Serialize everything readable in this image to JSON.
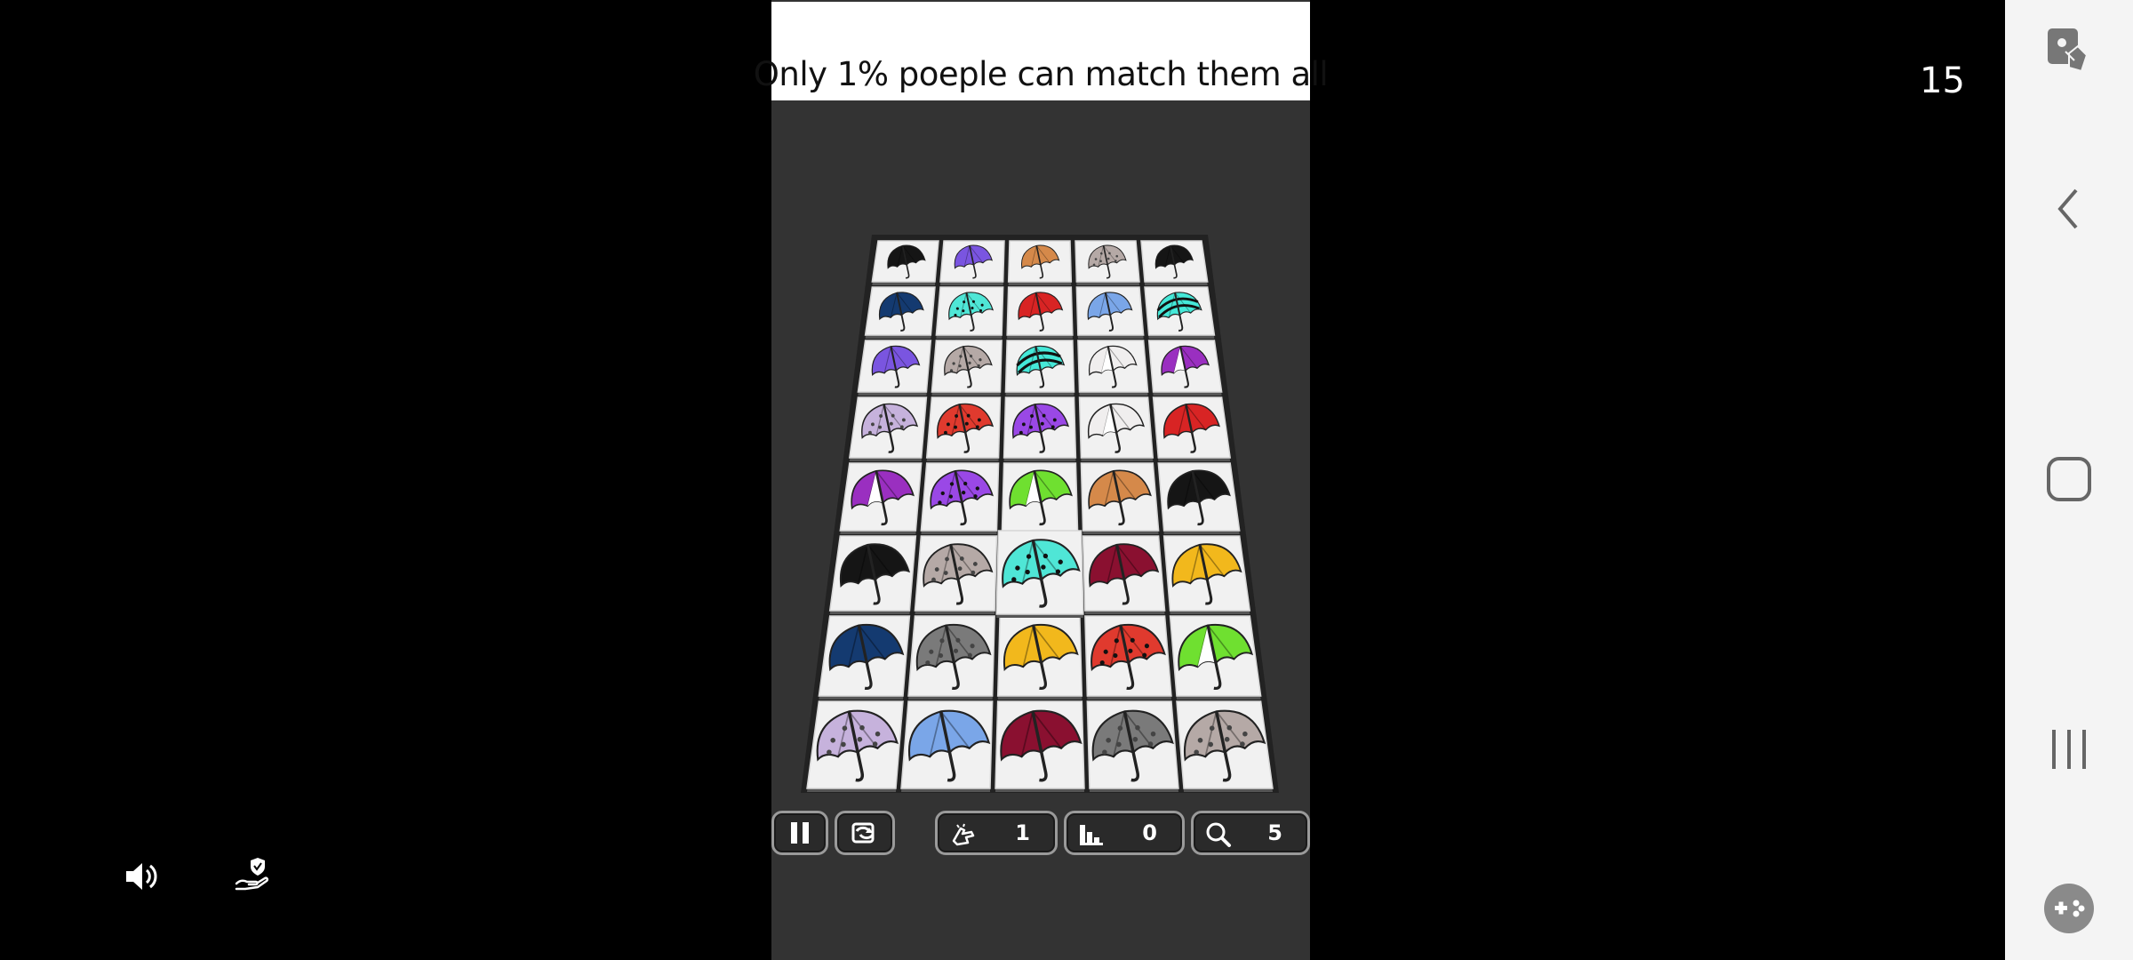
{
  "banner": {
    "title": "Only 1% poeple can match them all"
  },
  "counter": {
    "value": "15"
  },
  "hud": {
    "pause_label": "pause",
    "shuffle_label": "shuffle",
    "hint": {
      "icon": "hint-hand-icon",
      "count": "1"
    },
    "undo": {
      "icon": "stairs-icon",
      "count": "0"
    },
    "search": {
      "icon": "magnifier-icon",
      "count": "5"
    }
  },
  "overlay": {
    "sound_icon": "speaker-icon",
    "privacy_icon": "hand-shield-icon"
  },
  "navbar": {
    "items": [
      "screenshot-touch-icon",
      "back-icon",
      "home-icon",
      "recents-icon",
      "game-tools-icon"
    ]
  },
  "board": {
    "rows": [
      [
        "black",
        "purple",
        "tan",
        "beige-lace",
        "black"
      ],
      [
        "navy",
        "teal-dots",
        "red",
        "blue-pattern",
        "teal-stripes"
      ],
      [
        "purple",
        "beige-lace",
        "teal-stripes",
        "white-clear",
        "violet-white"
      ],
      [
        "lavender-lace",
        "red-dots",
        "violet-dots",
        "white-clear",
        "red"
      ],
      [
        "violet-white",
        "violet-dots",
        "green-white",
        "tan",
        "black"
      ],
      [
        "black",
        "beige-lace",
        "teal-dots",
        "maroon",
        "yellow"
      ],
      [
        "navy",
        "black-lace",
        "yellow",
        "red-dots",
        "green-white"
      ],
      [
        "lavender-lace",
        "blue-pattern",
        "maroon",
        "black-lace",
        "beige-lace"
      ]
    ],
    "colors": {
      "black": "#151515",
      "purple": "#7a55e0",
      "tan": "#d5894a",
      "beige-lace": "#b5a9a6",
      "navy": "#143a70",
      "teal-dots": "#4fe6d6",
      "red": "#d82424",
      "blue-pattern": "#7aa6e8",
      "teal-stripes": "#45e8d8",
      "white-clear": "#f0eeee",
      "violet-white": "#9a2fc0",
      "lavender-lace": "#c6b2dc",
      "red-dots": "#e03a2e",
      "violet-dots": "#9a48e6",
      "green-white": "#6fe030",
      "maroon": "#8a1030",
      "yellow": "#f2b81c",
      "black-lace": "#7a7a7a"
    },
    "selected": {
      "row": 5,
      "col": 2
    }
  }
}
